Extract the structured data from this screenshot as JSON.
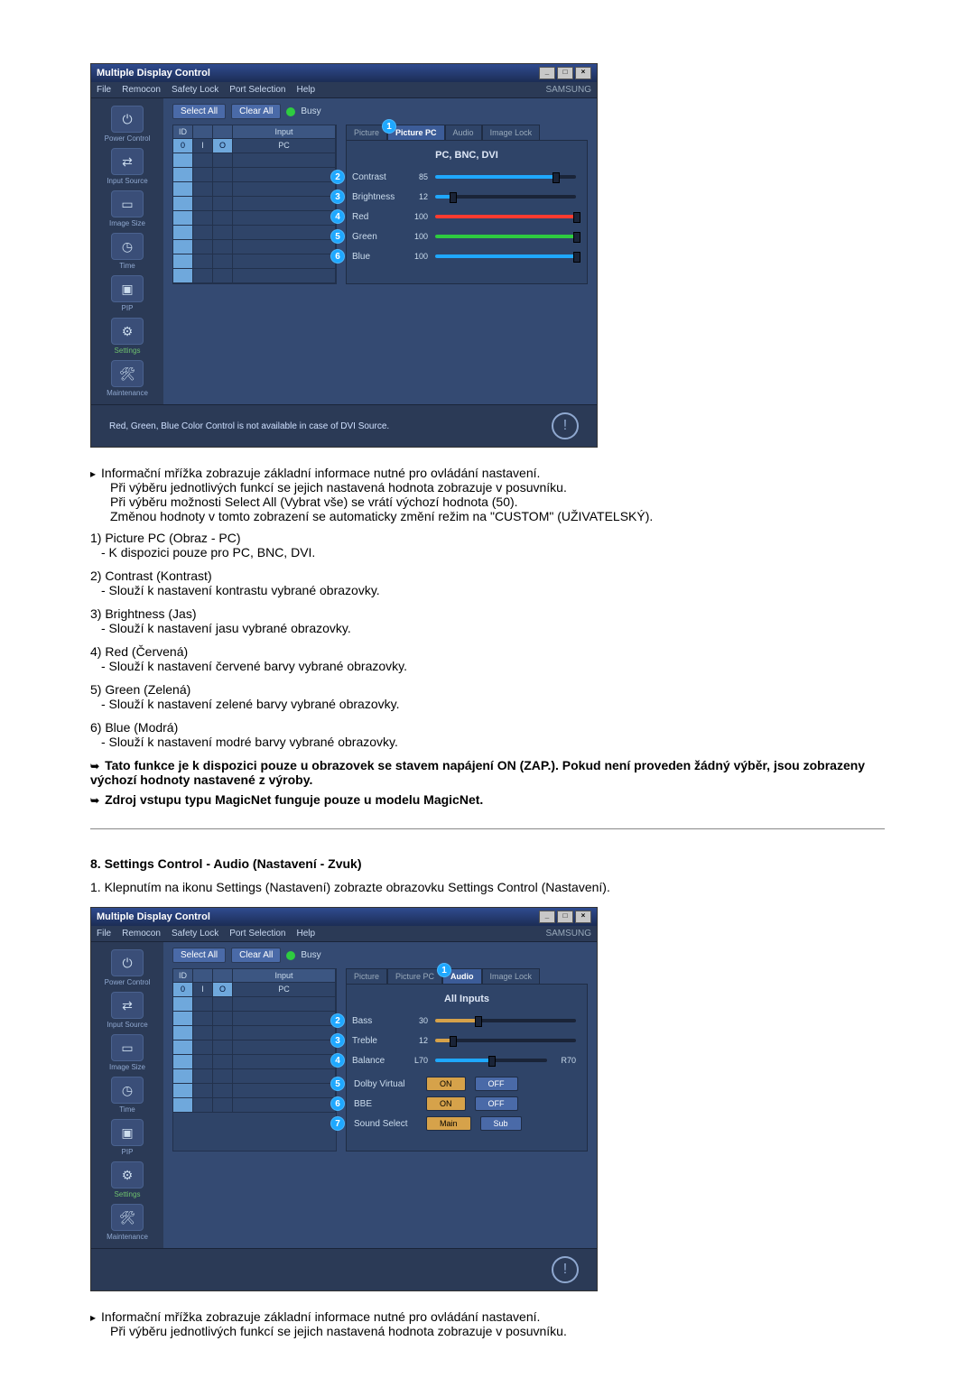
{
  "app1": {
    "title": "Multiple Display Control",
    "menu": [
      "File",
      "Remocon",
      "Safety Lock",
      "Port Selection",
      "Help"
    ],
    "brand": "SAMSUNG",
    "select_all": "Select All",
    "clear_all": "Clear All",
    "busy": "Busy",
    "sidenav": [
      {
        "label": "Power Control",
        "glyph": "⏻"
      },
      {
        "label": "Input Source",
        "glyph": "⇄"
      },
      {
        "label": "Image Size",
        "glyph": "▭"
      },
      {
        "label": "Time",
        "glyph": "◷"
      },
      {
        "label": "PIP",
        "glyph": "▣"
      },
      {
        "label": "Settings",
        "glyph": "⚙"
      },
      {
        "label": "Maintenance",
        "glyph": "🛠"
      }
    ],
    "grid_headers": {
      "c1": "ID",
      "c2": "",
      "c3": "",
      "c4": "Input"
    },
    "grid_row1": {
      "c1": "0",
      "c2": "I",
      "c3": "O",
      "c4": "PC"
    },
    "tabs": [
      "Picture",
      "Picture PC",
      "Audio",
      "Image Lock"
    ],
    "panel_title": "PC, BNC, DVI",
    "rows": [
      {
        "n": "2",
        "label": "Contrast",
        "val": "85",
        "pct": 85,
        "color": "#1fa8ff"
      },
      {
        "n": "3",
        "label": "Brightness",
        "val": "12",
        "pct": 12,
        "color": "#1fa8ff"
      },
      {
        "n": "4",
        "label": "Red",
        "val": "100",
        "pct": 100,
        "color": "#ff3b30"
      },
      {
        "n": "5",
        "label": "Green",
        "val": "100",
        "pct": 100,
        "color": "#2ecc40"
      },
      {
        "n": "6",
        "label": "Blue",
        "val": "100",
        "pct": 100,
        "color": "#1fa8ff"
      }
    ],
    "note": "Red, Green, Blue Color Control is not available in case of DVI Source."
  },
  "doc1": {
    "intro": [
      "Informační mřížka zobrazuje základní informace nutné pro ovládání nastavení.",
      "Při výběru jednotlivých funkcí se jejich nastavená hodnota zobrazuje v posuvníku.",
      "Při výběru možnosti Select All (Vybrat vše) se vrátí výchozí hodnota (50).",
      "Změnou hodnoty v tomto zobrazení se automaticky změní režim na \"CUSTOM\" (UŽIVATELSKÝ)."
    ],
    "items": [
      {
        "n": "1)",
        "t": "Picture PC (Obraz - PC)",
        "d": "- K dispozici pouze pro PC, BNC, DVI."
      },
      {
        "n": "2)",
        "t": "Contrast (Kontrast)",
        "d": "- Slouží k nastavení kontrastu vybrané obrazovky."
      },
      {
        "n": "3)",
        "t": "Brightness (Jas)",
        "d": "- Slouží k nastavení jasu vybrané obrazovky."
      },
      {
        "n": "4)",
        "t": "Red (Červená)",
        "d": "- Slouží k nastavení červené barvy vybrané obrazovky."
      },
      {
        "n": "5)",
        "t": "Green (Zelená)",
        "d": "- Slouží k nastavení zelené barvy vybrané obrazovky."
      },
      {
        "n": "6)",
        "t": "Blue (Modrá)",
        "d": "- Slouží k nastavení modré barvy vybrané obrazovky."
      }
    ],
    "notes": [
      "Tato funkce je k dispozici pouze u obrazovek se stavem napájení ON (ZAP.). Pokud není proveden žádný výběr, jsou zobrazeny výchozí hodnoty nastavené z výroby.",
      "Zdroj vstupu typu MagicNet funguje pouze u modelu MagicNet."
    ]
  },
  "section2": {
    "heading": "8. Settings Control - Audio (Nastavení - Zvuk)",
    "step": "1.  Klepnutím na ikonu Settings (Nastavení) zobrazte obrazovku Settings Control (Nastavení)."
  },
  "app2": {
    "title": "Multiple Display Control",
    "menu": [
      "File",
      "Remocon",
      "Safety Lock",
      "Port Selection",
      "Help"
    ],
    "brand": "SAMSUNG",
    "select_all": "Select All",
    "clear_all": "Clear All",
    "busy": "Busy",
    "tabs": [
      "Picture",
      "Picture PC",
      "Audio",
      "Image Lock"
    ],
    "panel_title": "All Inputs",
    "sliders": [
      {
        "n": "2",
        "label": "Bass",
        "val": "30",
        "pct": 30,
        "color": "#d6a24a"
      },
      {
        "n": "3",
        "label": "Treble",
        "val": "12",
        "pct": 12,
        "color": "#d6a24a"
      },
      {
        "n": "4",
        "label": "Balance",
        "val": "L70",
        "pct": 50,
        "color": "#1fa8ff",
        "rlabel": "R70"
      }
    ],
    "toggles": [
      {
        "n": "5",
        "label": "Dolby Virtual",
        "on": "ON",
        "off": "OFF"
      },
      {
        "n": "6",
        "label": "BBE",
        "on": "ON",
        "off": "OFF"
      },
      {
        "n": "7",
        "label": "Sound Select",
        "on": "Main",
        "off": "Sub"
      }
    ]
  },
  "doc2": {
    "intro": [
      "Informační mřížka zobrazuje základní informace nutné pro ovládání nastavení.",
      "Při výběru jednotlivých funkcí se jejich nastavená hodnota zobrazuje v posuvníku."
    ]
  }
}
